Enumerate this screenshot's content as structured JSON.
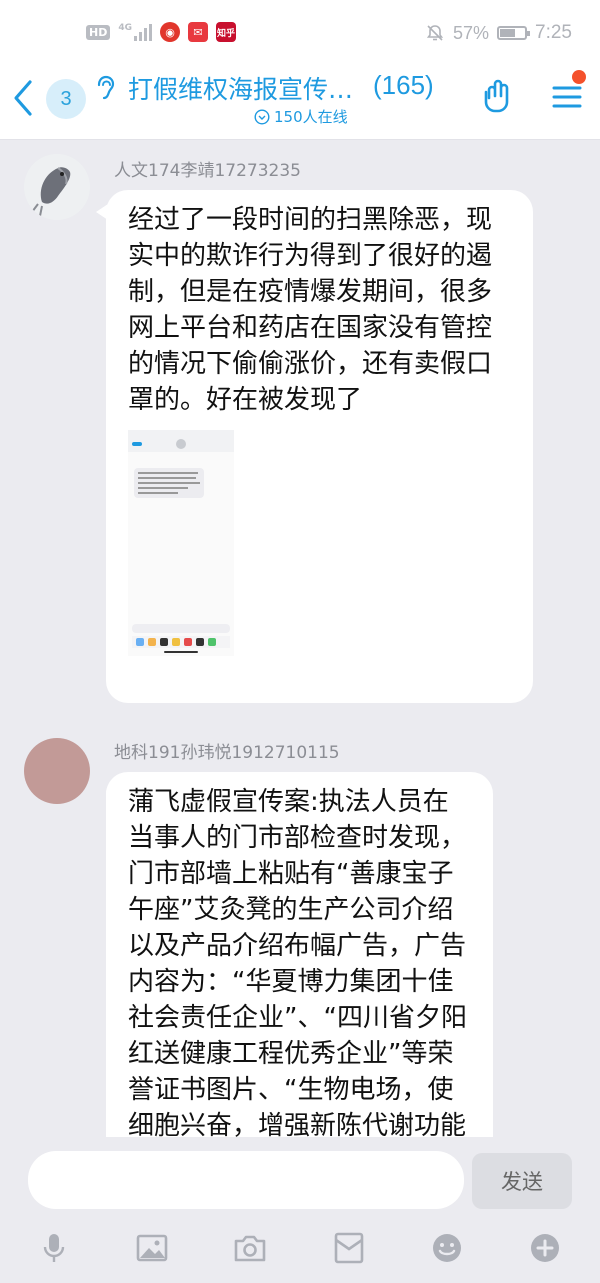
{
  "status_bar": {
    "hd": "HD",
    "network": "4G",
    "battery_text": "57%",
    "battery_level": 0.57,
    "time": "7:25",
    "app_badge_text": "知乎"
  },
  "header": {
    "unread_count": "3",
    "group_name": "打假维权海报宣传…",
    "member_count": "(165)",
    "online_text": "150人在线"
  },
  "messages": [
    {
      "sender": "人文174李靖17273235",
      "text": "经过了一段时间的扫黑除恶，现实中的欺诈行为得到了很好的遏制，但是在疫情爆发期间，很多网上平台和药店在国家没有管控的情况下偷偷涨价，还有卖假口罩的。好在被发现了"
    },
    {
      "sender": "地科191孙玮悦1912710115",
      "text": "蒲飞虚假宣传案:执法人员在当事人的门市部检查时发现，门市部墙上粘贴有“善康宝子午座”艾灸凳的生产公司介绍以及产品介绍布幅广告，广告内容为：“华夏博力集团十佳社会责任企业”、“四川省夕阳红送健康工程优秀企业”等荣誉证书图片、“生物电场，使细胞兴奋，增强新陈代谢功能"
    }
  ],
  "composer": {
    "send_label": "发送"
  },
  "icons": [
    "back-arrow-icon",
    "ear-icon",
    "hand-gesture-icon",
    "menu-icon",
    "microphone-icon",
    "image-icon",
    "camera-icon",
    "red-packet-icon",
    "emoji-icon",
    "plus-icon"
  ],
  "colors": {
    "accent": "#1e9ae0",
    "background": "#ebebf0",
    "badge_dot": "#f4512c"
  }
}
